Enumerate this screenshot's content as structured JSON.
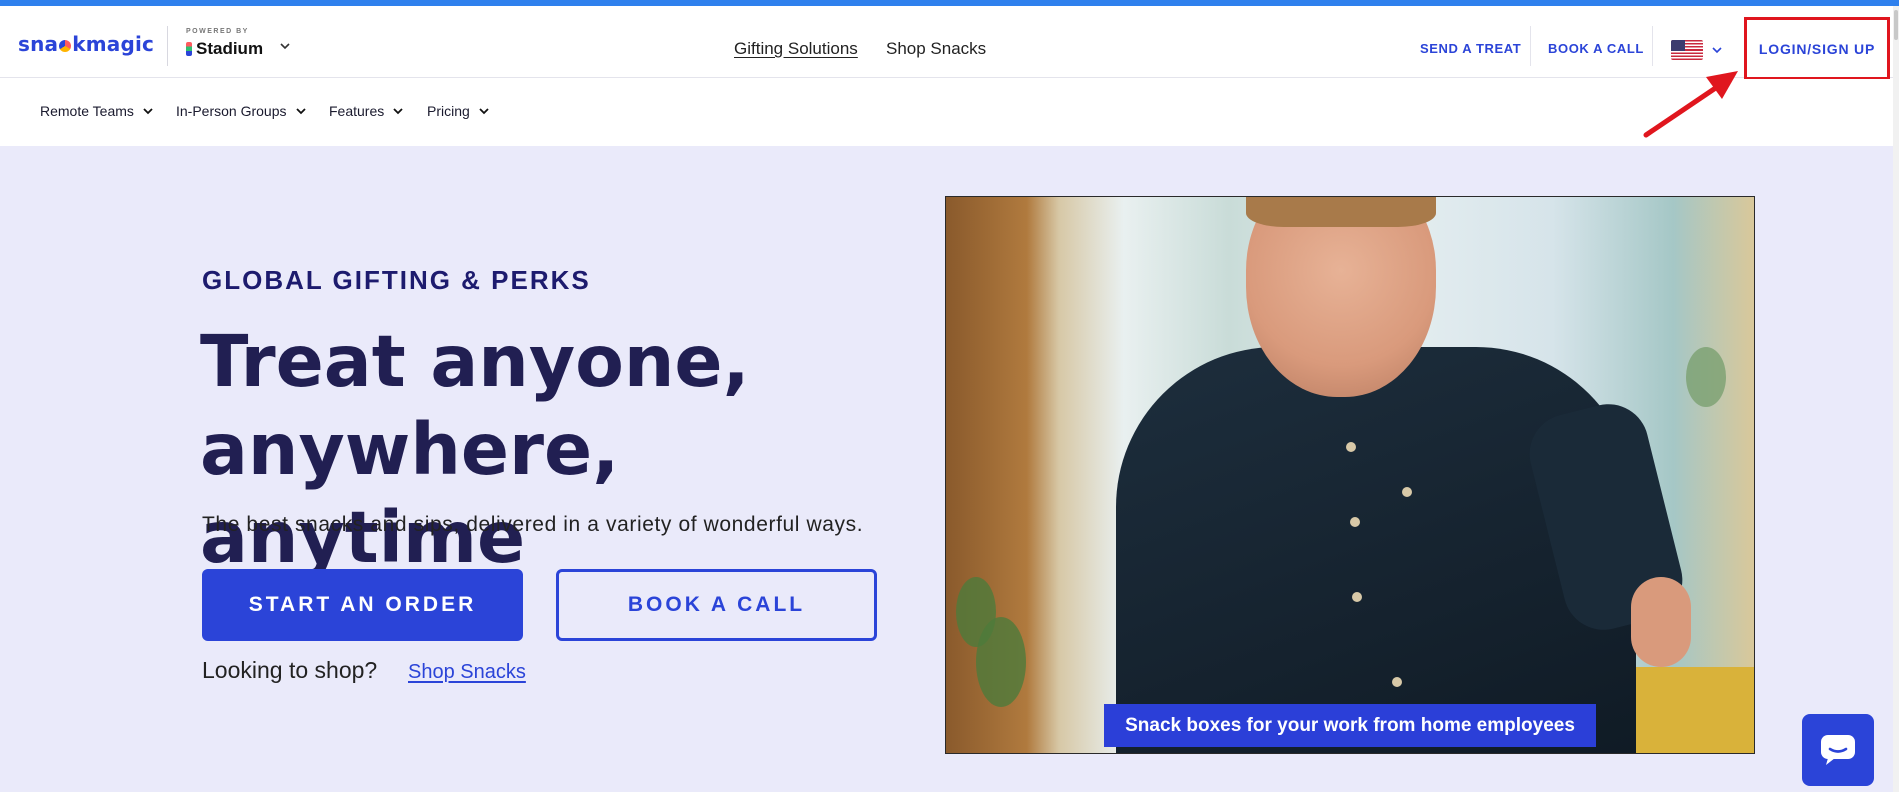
{
  "header": {
    "logo_text_pre": "sna",
    "logo_text_post": "kmagic",
    "powered_by": "POWERED BY",
    "partner": "Stadium",
    "center_nav": [
      "Gifting Solutions",
      "Shop Snacks"
    ],
    "right_links": {
      "send_treat": "SEND A TREAT",
      "book_call": "BOOK A CALL",
      "login": "LOGIN/SIGN UP"
    },
    "region_icon": "us-flag-icon"
  },
  "subnav": {
    "items": [
      "Remote Teams",
      "In-Person Groups",
      "Features",
      "Pricing"
    ]
  },
  "hero": {
    "eyebrow": "GLOBAL GIFTING & PERKS",
    "headline_line1": "Treat anyone,",
    "headline_line2": "anywhere, anytime",
    "subtext": "The best snacks and sips, delivered in a variety of wonderful ways.",
    "primary_button": "START AN ORDER",
    "secondary_button": "BOOK A CALL",
    "shop_prompt": "Looking to shop?",
    "shop_link": "Shop Snacks",
    "media_caption": "Snack boxes for your work from home employees"
  },
  "colors": {
    "brand_blue": "#2b44d8",
    "hero_bg": "#eaeafa",
    "highlight_red": "#e0161e",
    "top_strip": "#2f80ed"
  }
}
